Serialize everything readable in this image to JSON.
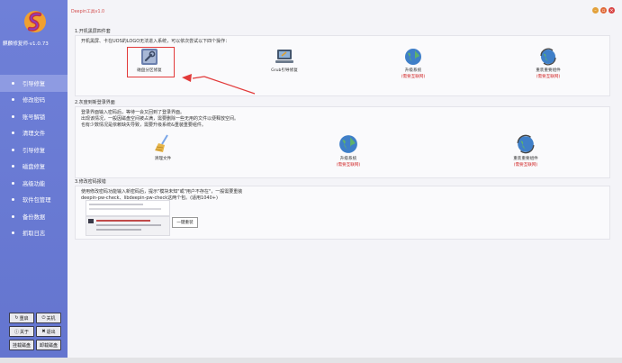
{
  "window": {
    "title": "Deepin工具v1.0"
  },
  "app": {
    "brand": "麒麟修复师·v1.0.73"
  },
  "sidebar": {
    "items": [
      {
        "label": "引导修复",
        "active": true
      },
      {
        "label": "修改密码"
      },
      {
        "label": "账号解锁"
      },
      {
        "label": "清理文件"
      },
      {
        "label": "引导修复"
      },
      {
        "label": "磁盘修复"
      },
      {
        "label": "高级功能"
      },
      {
        "label": "软件包管理"
      },
      {
        "label": "备份数据"
      },
      {
        "label": "抓取日志"
      }
    ],
    "buttons": [
      {
        "label": "重启",
        "icon": "refresh-icon"
      },
      {
        "label": "关机",
        "icon": "power-icon"
      },
      {
        "label": "关于",
        "icon": "info-icon"
      },
      {
        "label": "退出",
        "icon": "close-icon"
      },
      {
        "label": "挂载磁盘",
        "icon": ""
      },
      {
        "label": "卸载磁盘",
        "icon": ""
      }
    ]
  },
  "sections": [
    {
      "title": "1.开机黑屏四件套",
      "intro": [
        "开机黑屏、卡在UOS的LOGO无法进入系统，可以依次尝试以下四个操作："
      ],
      "tools": [
        {
          "label": "磁盘分区修复",
          "warn": ""
        },
        {
          "label": "Grub引导修复",
          "warn": ""
        },
        {
          "label": "升级系统",
          "warn": "(需要互联网)"
        },
        {
          "label": "重装重要组件",
          "warn": "(需要互联网)"
        }
      ]
    },
    {
      "title": "2.灰度到新登录界面",
      "intro": [
        "登录界面输入密码后，等待一会又回到了登录界面。",
        "出现该情况，一般因磁盘空间被占满，需要删除一些无用的文件以便释放空间。",
        "也有少数情况是依赖缺失导致，需要升级系统&重装重要组件。"
      ],
      "tools": [
        {
          "label": "清理文件",
          "warn": ""
        },
        {
          "label": "升级系统",
          "warn": "(需要互联网)"
        },
        {
          "label": "重装重要组件",
          "warn": "(需要互联网)"
        }
      ]
    },
    {
      "title": "3.修改密码报错",
      "intro": [
        "使用修改密码功能输入新密码后，提示\"模块未知\"或\"用户不存在\"，一般需要重装",
        "deepin-pw-check、libdeepin-pw-check这两个包。(适用1040+)"
      ],
      "repair_button": "一键重装"
    }
  ],
  "colors": {
    "sidebar": "#6f80d8",
    "sidebar_active": "#8e9be2",
    "highlight": "#e23a3a",
    "warn_text": "#d12828"
  }
}
